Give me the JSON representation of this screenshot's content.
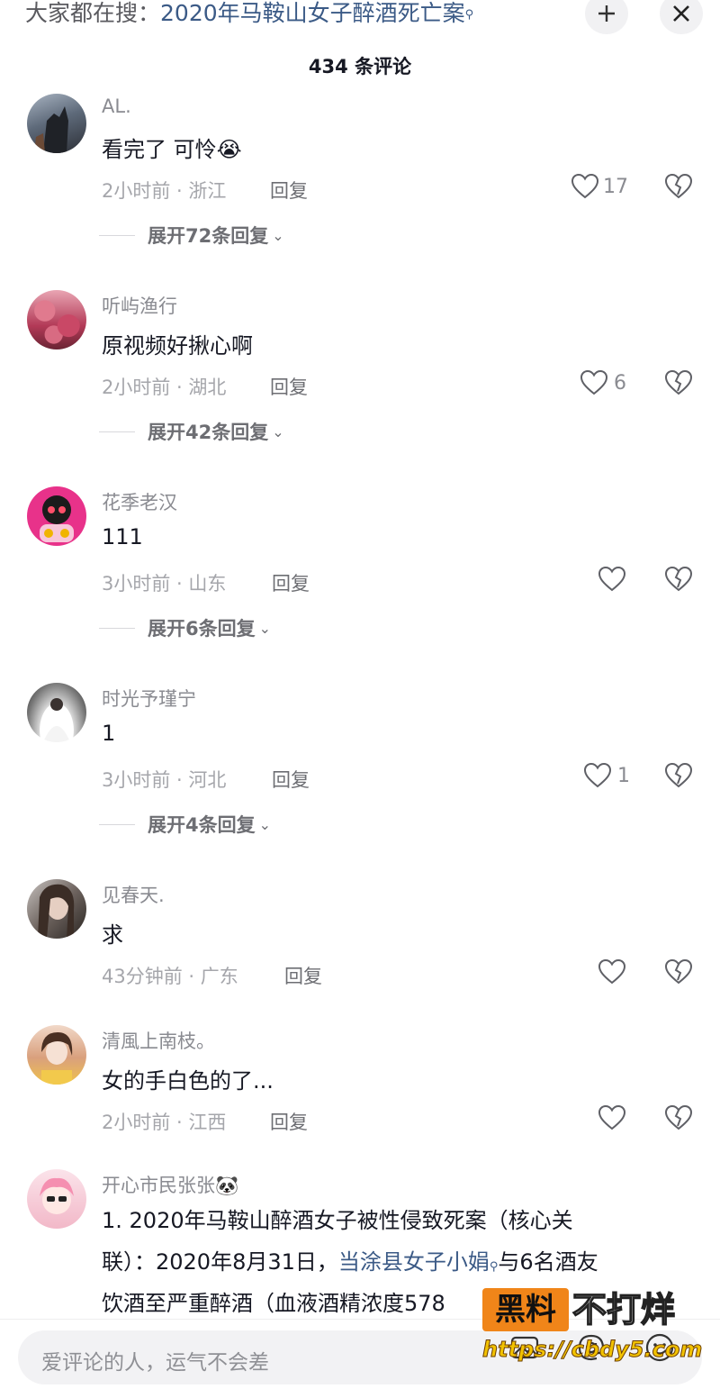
{
  "header": {
    "search_hint_prefix": "大家都在搜：",
    "search_hint_keyword": "2020年马鞍山女子醉酒死亡案",
    "comment_count_title": "434 条评论"
  },
  "reply_label": "回复",
  "comments": [
    {
      "username": "AL.",
      "content": "看完了 可怜😭",
      "time": "2小时前",
      "location": "浙江",
      "likes": "17",
      "expand_label": "展开72条回复"
    },
    {
      "username": "听屿渔行",
      "content": "原视频好揪心啊",
      "time": "2小时前",
      "location": "湖北",
      "likes": "6",
      "expand_label": "展开42条回复"
    },
    {
      "username": "花季老汉",
      "content": "111",
      "time": "3小时前",
      "location": "山东",
      "likes": "",
      "expand_label": "展开6条回复"
    },
    {
      "username": "时光予瑾宁",
      "content": "1",
      "time": "3小时前",
      "location": "河北",
      "likes": "1",
      "expand_label": "展开4条回复"
    },
    {
      "username": "见春天.",
      "content": "求",
      "time": "43分钟前",
      "location": "广东",
      "likes": ""
    },
    {
      "username": "清風上南枝。",
      "content": "女的手白色的了...",
      "time": "2小时前",
      "location": "江西",
      "likes": ""
    },
    {
      "username": "开心市民张张🐼",
      "content_part1": "1. 2020年马鞍山醉酒女子被性侵致死案（核心关",
      "content_part2": "联）：2020年8月31日，",
      "content_keyword": "当涂县女子小娟",
      "content_part3": "与6名酒友",
      "content_part4": "饮酒至严重醉酒（血液酒精浓度578"
    }
  ],
  "input": {
    "placeholder": "爱评论的人，运气不会差"
  },
  "watermark": {
    "badge": "黑料",
    "text": "不打烊",
    "url": "https://cbdy5.com"
  },
  "colors": {
    "keyword_blue": "#3b5a86",
    "username_gray": "#8a8b91",
    "meta_gray": "#a5a6ab"
  }
}
